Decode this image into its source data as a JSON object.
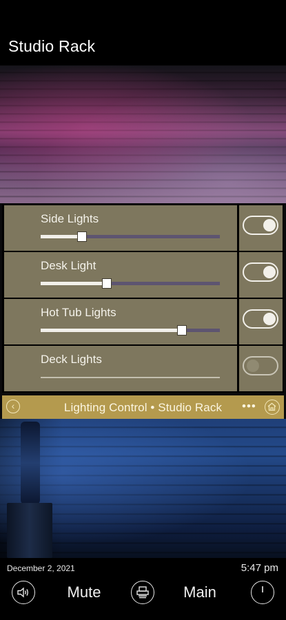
{
  "header": {
    "title": "Studio Rack"
  },
  "lights": [
    {
      "label": "Side Lights",
      "level": 0.23,
      "on": true
    },
    {
      "label": "Desk Light",
      "level": 0.37,
      "on": true
    },
    {
      "label": "Hot Tub Lights",
      "level": 0.79,
      "on": true
    },
    {
      "label": "Deck Lights",
      "level": 0.0,
      "on": false
    }
  ],
  "control_bar": {
    "title": "Lighting Control • Studio Rack",
    "back_icon": "chevron-left-icon",
    "more_label": "•••",
    "home_icon": "home-icon"
  },
  "footer": {
    "date": "December 2, 2021",
    "time": "5:47 pm",
    "volume_icon": "speaker-icon",
    "mute_label": "Mute",
    "remote_icon": "printer-icon",
    "main_label": "Main",
    "power_icon": "power-icon"
  },
  "colors": {
    "panel": "#7e775e",
    "bar": "#b49a4e",
    "slider_track": "#5d5470"
  }
}
